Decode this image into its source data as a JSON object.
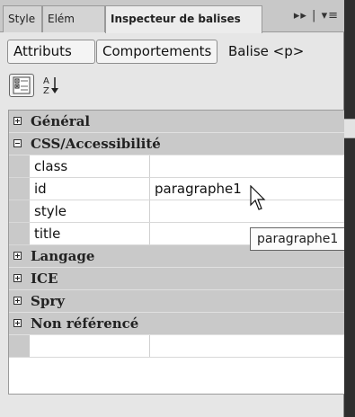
{
  "tabs": [
    {
      "label": "Style"
    },
    {
      "label": "Elém"
    },
    {
      "label": "Inspecteur de balises"
    }
  ],
  "tab_menu": "▸▸ | ▾≡",
  "subtabs": {
    "attributes": "Attributs",
    "behaviors": "Comportements",
    "tag_label": "Balise <p>"
  },
  "toolbar": {
    "category_view_icon": "category-view-icon",
    "sort_az_icon": "sort-az-icon"
  },
  "grid": {
    "categories": [
      {
        "label": "Général",
        "expanded": false
      },
      {
        "label": "CSS/Accessibilité",
        "expanded": true
      },
      {
        "label": "Langage",
        "expanded": false
      },
      {
        "label": "ICE",
        "expanded": false
      },
      {
        "label": "Spry",
        "expanded": false
      },
      {
        "label": "Non référencé",
        "expanded": false
      }
    ],
    "properties": [
      {
        "name": "class",
        "value": ""
      },
      {
        "name": "id",
        "value": "paragraphe1"
      },
      {
        "name": "style",
        "value": ""
      },
      {
        "name": "title",
        "value": ""
      }
    ]
  },
  "tooltip": "paragraphe1"
}
